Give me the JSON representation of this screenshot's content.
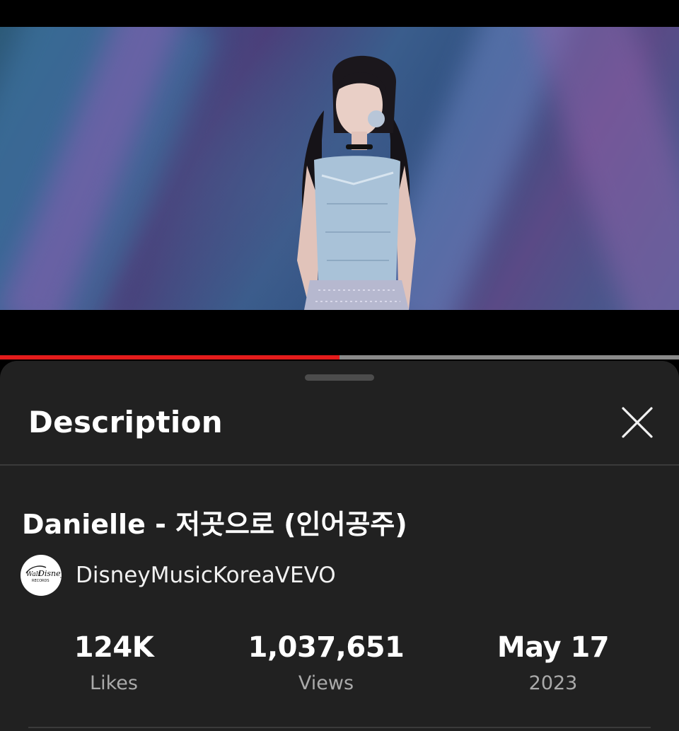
{
  "player": {
    "progress_fraction": 0.5,
    "colors": {
      "played": "#e31b1b",
      "buffered": "#8a8a8a"
    }
  },
  "sheet": {
    "title": "Description",
    "close_icon": "close-icon"
  },
  "video": {
    "title": "Danielle - 저곳으로 (인어공주)",
    "channel": {
      "name": "DisneyMusicKoreaVEVO",
      "avatar_text": "Walt Disney Records"
    }
  },
  "stats": [
    {
      "value": "124K",
      "label": "Likes"
    },
    {
      "value": "1,037,651",
      "label": "Views"
    },
    {
      "value": "May 17",
      "label": "2023"
    }
  ],
  "colors": {
    "sheet_background": "#212121",
    "secondary_text": "#aaaaaa"
  }
}
